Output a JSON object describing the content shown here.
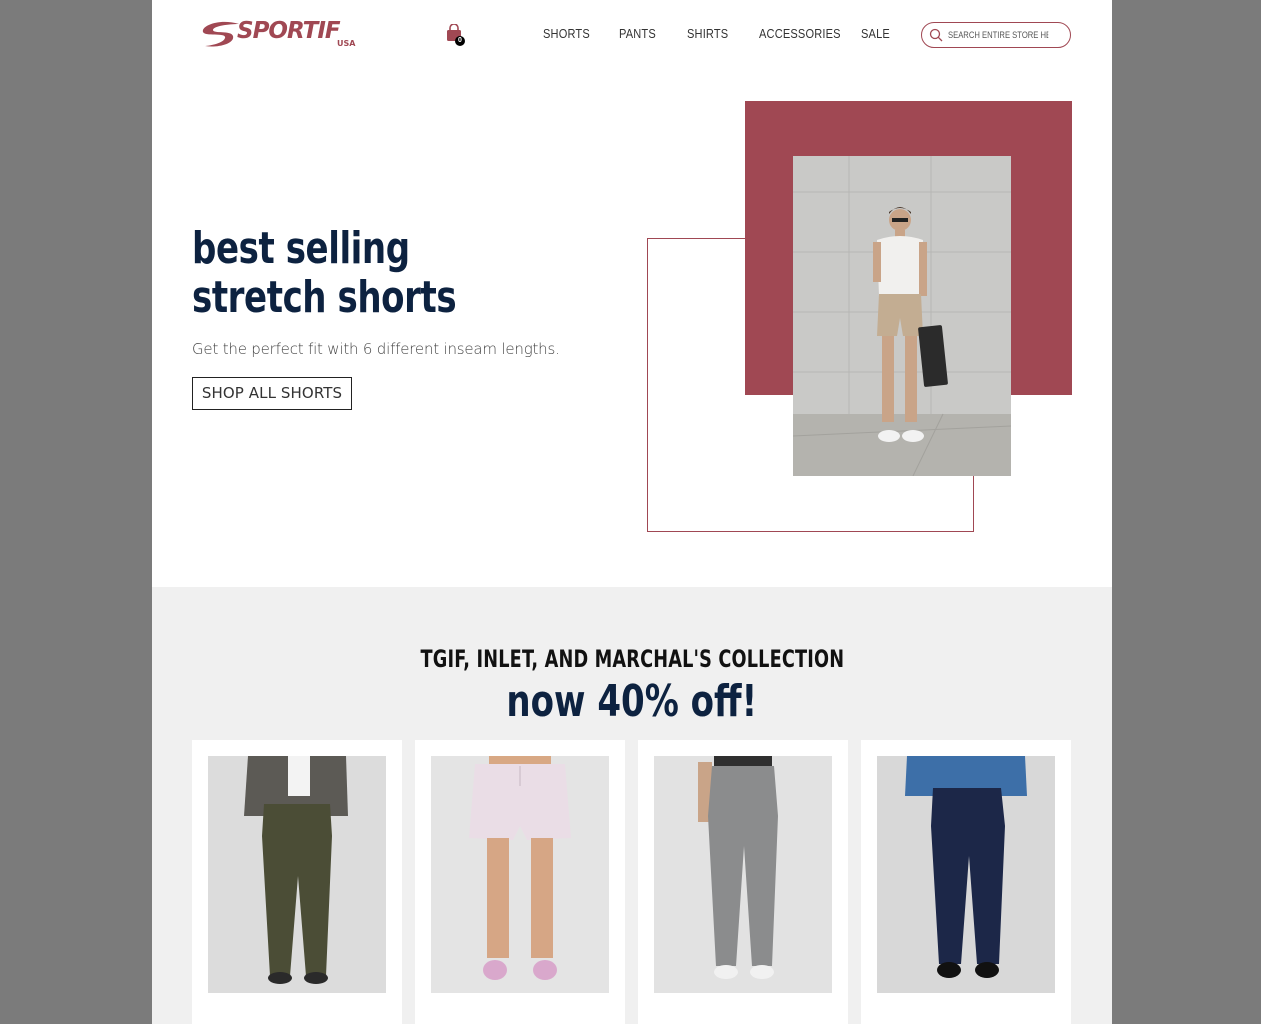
{
  "brand": {
    "logo_text": "SPORTIF",
    "logo_sub": "USA",
    "accent": "#a04853",
    "navy": "#0d2240"
  },
  "header": {
    "cart_count": "0",
    "nav": [
      "SHORTS",
      "PANTS",
      "SHIRTS",
      "ACCESSORIES",
      "SALE"
    ],
    "search_placeholder": "SEARCH ENTIRE STORE HERE"
  },
  "hero": {
    "title_line1": "best selling",
    "title_line2": "stretch shorts",
    "subtitle": "Get the perfect fit with 6 different inseam lengths.",
    "button": "SHOP ALL SHORTS"
  },
  "promo": {
    "line1": "TGIF, INLET, AND MARCHAL'S COLLECTION",
    "line2": "now 40% off!",
    "products": [
      {
        "name": ""
      },
      {
        "name": ""
      },
      {
        "name": ""
      },
      {
        "name": ""
      }
    ]
  }
}
